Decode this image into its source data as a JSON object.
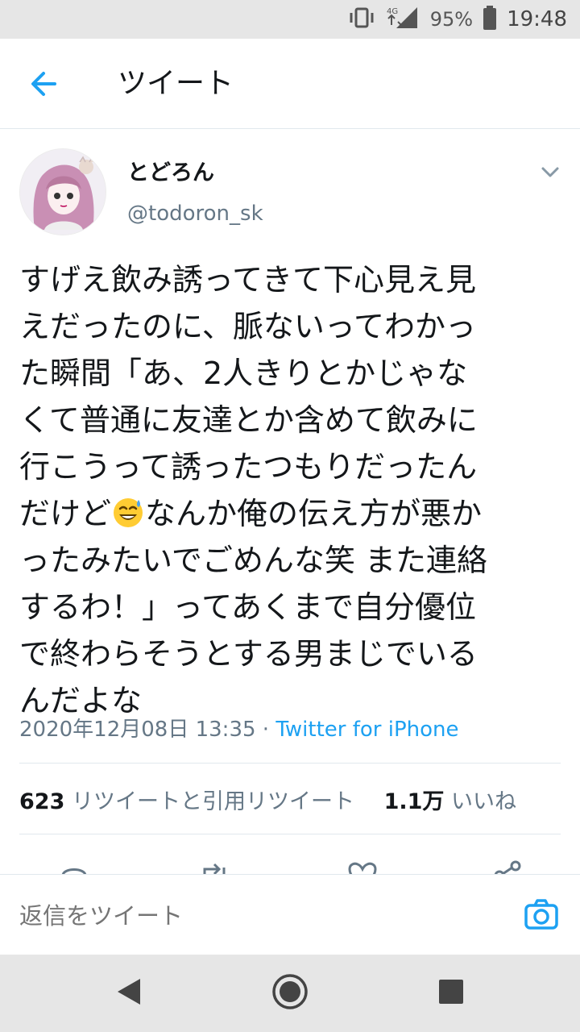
{
  "status_bar": {
    "network": "4G",
    "battery": "95%",
    "time": "19:48"
  },
  "header": {
    "title": "ツイート"
  },
  "tweet": {
    "author_name": "とどろん",
    "author_handle": "@todoron_sk",
    "text_lines": [
      "すげえ飲み誘ってきて下心見え見",
      "えだったのに、脈ないってわかっ",
      "た瞬間「あ、2人きりとかじゃな",
      "くて普通に友達とか含めて飲みに",
      "行こうって誘ったつもりだったん",
      "だけど",
      "なんか俺の伝え方が悪か",
      "ったみたいでごめんな笑 また連絡",
      "するわ！」ってあくまで自分優位",
      "で終わらそうとする男まじでいる",
      "んだよな"
    ],
    "timestamp": "2020年12月08日 13:35",
    "separator": " · ",
    "source": "Twitter for iPhone",
    "retweet_count": "623",
    "retweet_label": "リツイートと引用リツイート",
    "like_count": "1.1万",
    "like_label": "いいね"
  },
  "reply_bar": {
    "placeholder": "返信をツイート"
  },
  "colors": {
    "accent": "#1da1f2",
    "secondary_text": "#657786",
    "primary_text": "#14171a"
  },
  "icons": [
    "back-arrow-icon",
    "chevron-down-icon",
    "reply-icon",
    "retweet-icon",
    "like-icon",
    "share-icon",
    "camera-icon",
    "nav-back-icon",
    "nav-home-icon",
    "nav-recents-icon"
  ]
}
